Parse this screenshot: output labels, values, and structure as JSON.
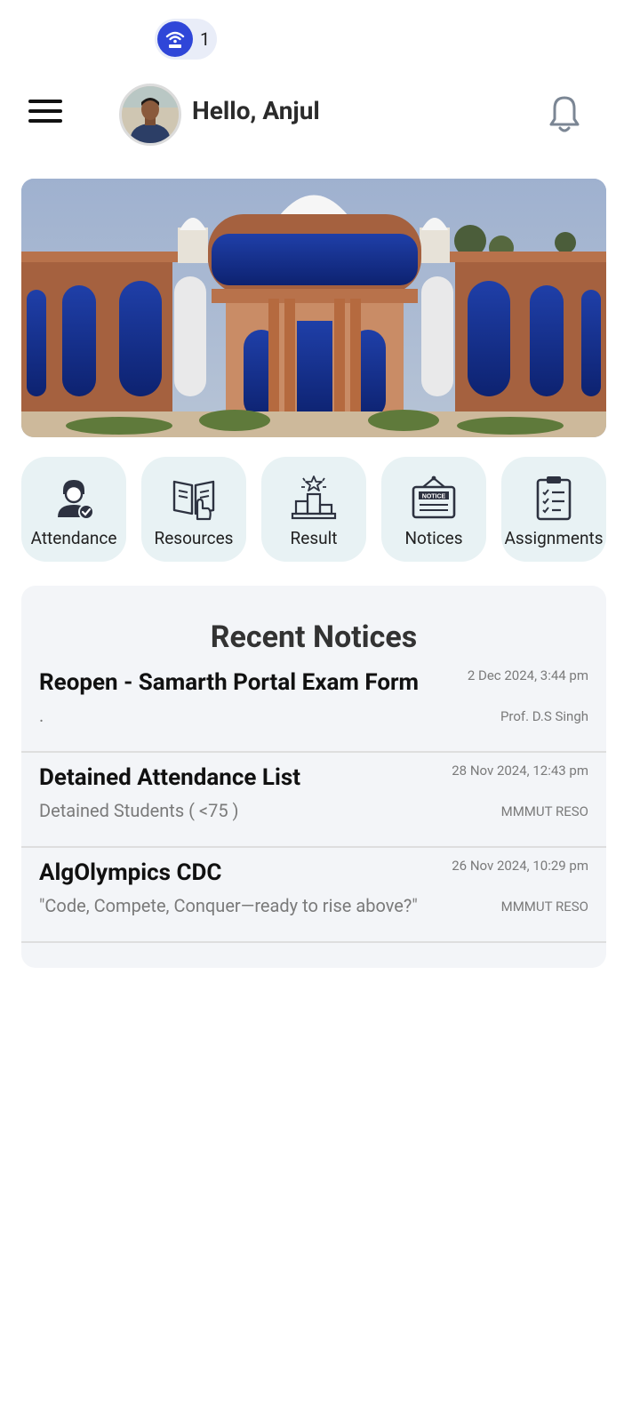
{
  "status_bar": {
    "notification_count": "1"
  },
  "header": {
    "greeting": "Hello, Anjul"
  },
  "quick_actions": [
    {
      "label": "Attendance",
      "icon": "attendance-icon"
    },
    {
      "label": "Resources",
      "icon": "book-icon"
    },
    {
      "label": "Result",
      "icon": "podium-icon"
    },
    {
      "label": "Notices",
      "icon": "notice-board-icon"
    },
    {
      "label": "Assignments",
      "icon": "clipboard-icon"
    }
  ],
  "recent_notices": {
    "title": "Recent Notices",
    "items": [
      {
        "title": "Reopen - Samarth Portal Exam Form",
        "subtitle": ".",
        "date": "2 Dec 2024, 3:44 pm",
        "author": "Prof. D.S Singh"
      },
      {
        "title": "Detained Attendance List",
        "subtitle": "Detained Students ( <75 )",
        "date": "28 Nov 2024, 12:43 pm",
        "author": "MMMUT RESO"
      },
      {
        "title": "AlgOlympics CDC",
        "subtitle": "\"Code, Compete, Conquer—ready to rise above?\"",
        "date": "26 Nov 2024, 10:29 pm",
        "author": "MMMUT RESO"
      }
    ]
  },
  "colors": {
    "accent": "#2f46d8",
    "tile_bg": "#e8f2f4",
    "card_bg": "#f3f5f8"
  }
}
